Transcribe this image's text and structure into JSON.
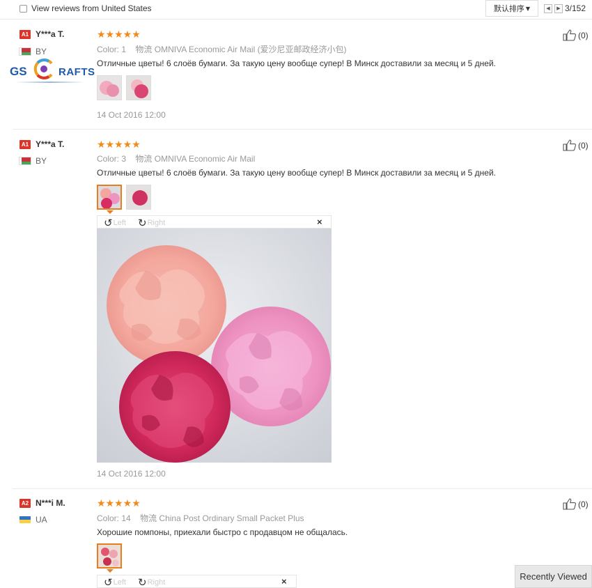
{
  "filter": {
    "label": "View reviews from United States",
    "checked": false
  },
  "sort": {
    "label": "默认排序"
  },
  "pager": {
    "current": "3/152"
  },
  "reviews": [
    {
      "level": "A1",
      "user": "Y***a T.",
      "country": "BY",
      "rating": 5,
      "color_label": "Color:",
      "color_value": "1",
      "logistics_label": "物流",
      "logistics_value": "OMNIVA Economic Air Mail (爱沙尼亚邮政经济小包)",
      "text": "Отличные цветы! 6 слоёв бумаги. За такую цену вообще супер! В Минск доставили за месяц и 5 дней.",
      "date": "14 Oct 2016 12:00",
      "likes": "(0)"
    },
    {
      "level": "A1",
      "user": "Y***a T.",
      "country": "BY",
      "rating": 5,
      "color_label": "Color:",
      "color_value": "3",
      "logistics_label": "物流",
      "logistics_value": "OMNIVA Economic Air Mail",
      "text": "Отличные цветы! 6 слоёв бумаги. За такую цену вообще супер! В Минск доставили за месяц и 5 дней.",
      "date": "14 Oct 2016 12:00",
      "likes": "(0)"
    },
    {
      "level": "A2",
      "user": "N***i M.",
      "country": "UA",
      "rating": 5,
      "color_label": "Color:",
      "color_value": "14",
      "logistics_label": "物流",
      "logistics_value": "China Post Ordinary Small Packet Plus",
      "text": "Хорошие помпоны, приехали быстро с продавцом не общалась.",
      "date": "",
      "likes": "(0)"
    }
  ],
  "viewer": {
    "rotate_left": "Left",
    "rotate_right": "Right",
    "close": "×"
  },
  "logo": {
    "part1": "GS",
    "part2": "RAFTS"
  },
  "recently_viewed": "Recently Viewed",
  "colors": {
    "accent": "#e87d1e",
    "stars": "#f28a18",
    "badge": "#d9352a"
  }
}
